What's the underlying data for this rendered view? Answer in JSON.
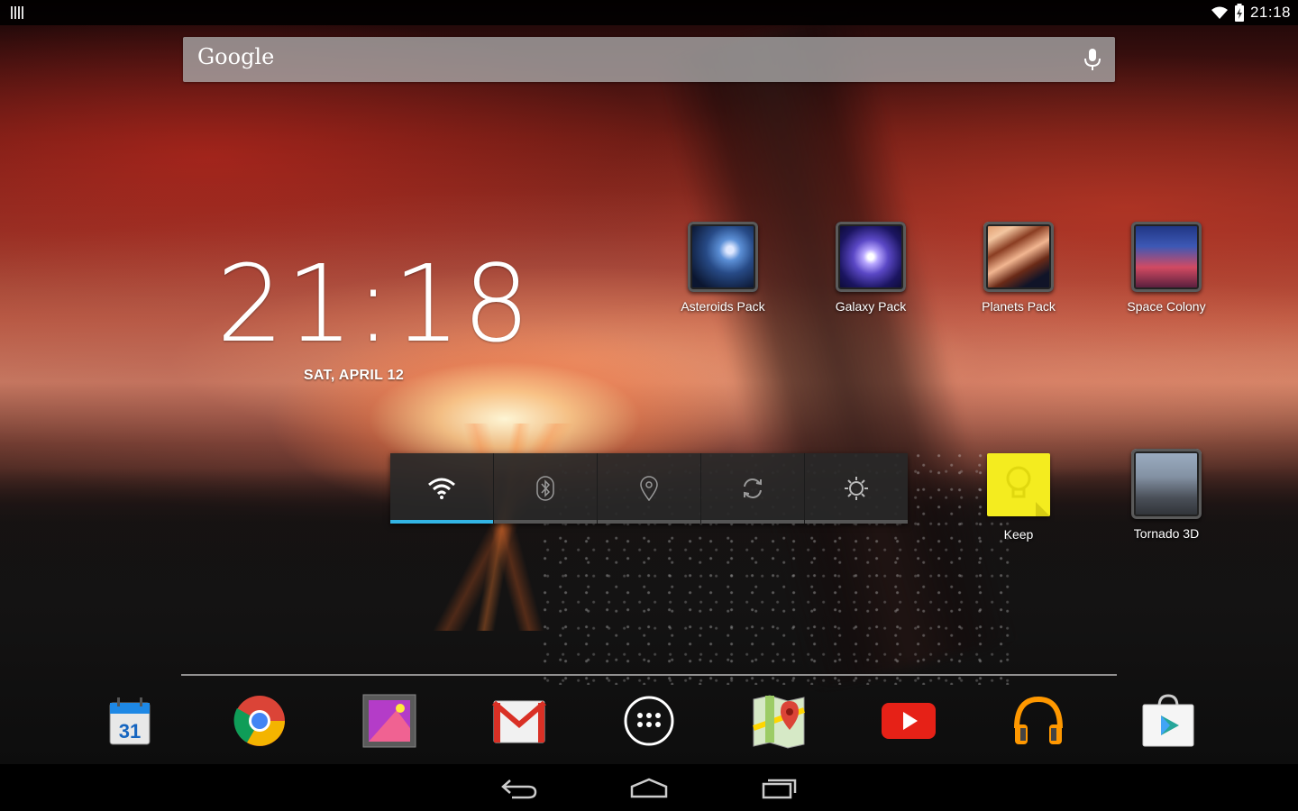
{
  "status_bar": {
    "time": "21:18",
    "icons": [
      "notification-icon",
      "wifi-icon",
      "battery-icon"
    ]
  },
  "search": {
    "logo_text": "Google",
    "mic_icon": "mic-icon"
  },
  "clock": {
    "time": "21:18",
    "date": "SAT, APRIL 12"
  },
  "desktop_apps": [
    {
      "label": "Asteroids Pack",
      "icon": "asteroids-pack-icon"
    },
    {
      "label": "Galaxy Pack",
      "icon": "galaxy-pack-icon"
    },
    {
      "label": "Planets Pack",
      "icon": "planets-pack-icon"
    },
    {
      "label": "Space Colony",
      "icon": "space-colony-icon"
    },
    {
      "label": "Keep",
      "icon": "keep-icon"
    },
    {
      "label": "Tornado 3D",
      "icon": "tornado-3d-icon"
    }
  ],
  "power_widget": {
    "toggles": [
      {
        "name": "wifi",
        "icon": "wifi-icon",
        "on": true
      },
      {
        "name": "bluetooth",
        "icon": "bluetooth-icon",
        "on": false
      },
      {
        "name": "location",
        "icon": "location-icon",
        "on": false
      },
      {
        "name": "sync",
        "icon": "sync-icon",
        "on": false
      },
      {
        "name": "brightness",
        "icon": "brightness-icon",
        "on": false
      }
    ]
  },
  "dock": {
    "apps": [
      {
        "name": "calendar",
        "icon": "calendar-icon",
        "badge_text": "31"
      },
      {
        "name": "chrome",
        "icon": "chrome-icon"
      },
      {
        "name": "gallery",
        "icon": "gallery-icon"
      },
      {
        "name": "gmail",
        "icon": "gmail-icon"
      },
      {
        "name": "all-apps",
        "icon": "apps-grid-icon"
      },
      {
        "name": "maps",
        "icon": "maps-icon"
      },
      {
        "name": "youtube",
        "icon": "youtube-icon"
      },
      {
        "name": "play-music",
        "icon": "headphones-icon"
      },
      {
        "name": "play-store",
        "icon": "play-store-icon"
      }
    ]
  },
  "nav_bar": {
    "buttons": [
      "back-icon",
      "home-icon",
      "recents-icon"
    ]
  },
  "colors": {
    "accent": "#33b5e5",
    "keep_yellow": "#f4ec1f",
    "gmail_red": "#d93025",
    "youtube_red": "#e62117"
  }
}
